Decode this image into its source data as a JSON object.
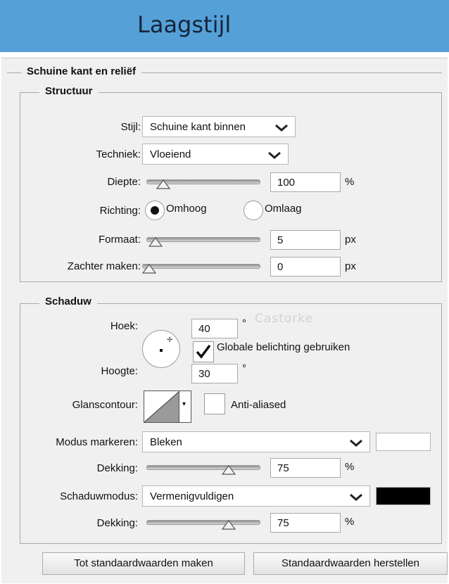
{
  "window": {
    "title": "Laagstijl"
  },
  "bevel": {
    "section_title": "Schuine kant en reliëf",
    "structure": {
      "title": "Structuur",
      "style": {
        "label": "Stijl:",
        "value": "Schuine kant binnen",
        "chevron_icon": "chevron-down-icon"
      },
      "technique": {
        "label": "Techniek:",
        "value": "Vloeiend",
        "chevron_icon": "chevron-down-icon"
      },
      "depth": {
        "label": "Diepte:",
        "value": "100",
        "unit": "%",
        "slider_level": 0.1
      },
      "direction": {
        "label": "Richting:",
        "options": [
          "Omhoog",
          "Omlaag"
        ],
        "selected": "Omhoog"
      },
      "size": {
        "label": "Formaat:",
        "value": "5",
        "unit": "px",
        "slider_level": 0.02
      },
      "soften": {
        "label": "Zachter maken:",
        "value": "0",
        "unit": "px",
        "slider_level": 0.0
      }
    },
    "shading": {
      "title": "Schaduw",
      "angle": {
        "label": "Hoek:",
        "value": "40",
        "unit": "°"
      },
      "watermark": "Castorke",
      "global_light": {
        "label": "Globale belichting gebruiken",
        "checked": true
      },
      "altitude": {
        "label": "Hoogte:",
        "value": "30",
        "unit": "°"
      },
      "gloss_contour": {
        "label": "Glanscontour:"
      },
      "anti_aliased": {
        "label": "Anti-aliased",
        "checked": false
      },
      "highlight_mode": {
        "label": "Modus markeren:",
        "value": "Bleken",
        "color": "#ffffff"
      },
      "highlight_opacity": {
        "label": "Dekking:",
        "value": "75",
        "unit": "%",
        "slider_level": 0.75
      },
      "shadow_mode": {
        "label": "Schaduwmodus:",
        "value": "Vermenigvuldigen",
        "color": "#000000"
      },
      "shadow_opacity": {
        "label": "Dekking:",
        "value": "75",
        "unit": "%",
        "slider_level": 0.75
      }
    }
  },
  "buttons": {
    "make_default": "Tot standaardwaarden maken",
    "reset_default": "Standaardwaarden herstellen"
  },
  "colors": {
    "titlebar": "#56a0d8",
    "panel": "#f0f0f0"
  }
}
